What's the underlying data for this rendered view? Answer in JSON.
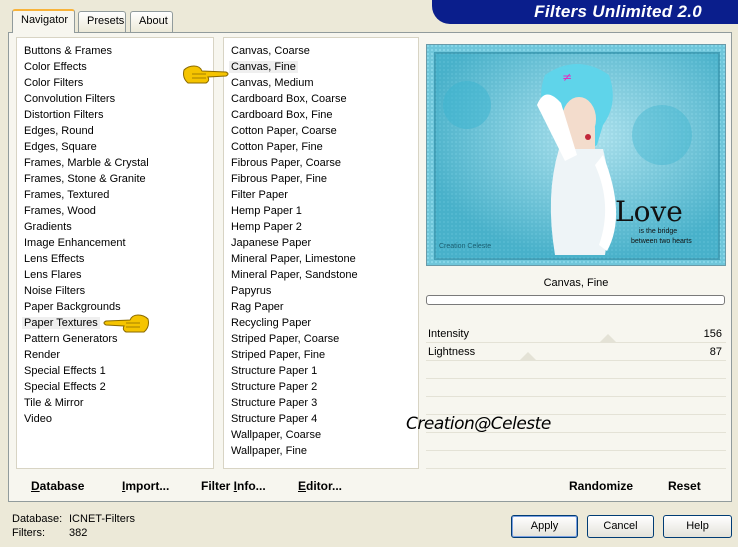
{
  "tabs": [
    {
      "label": "Navigator"
    },
    {
      "label": "Presets"
    },
    {
      "label": "About"
    }
  ],
  "banner_title": "Filters Unlimited 2.0",
  "categories": [
    "Buttons & Frames",
    "Color Effects",
    "Color Filters",
    "Convolution Filters",
    "Distortion Filters",
    "Edges, Round",
    "Edges, Square",
    "Frames, Marble & Crystal",
    "Frames, Stone & Granite",
    "Frames, Textured",
    "Frames, Wood",
    "Gradients",
    "Image Enhancement",
    "Lens Effects",
    "Lens Flares",
    "Noise Filters",
    "Paper Backgrounds",
    "Paper Textures",
    "Pattern Generators",
    "Render",
    "Special Effects 1",
    "Special Effects 2",
    "Tile & Mirror",
    "Video"
  ],
  "filters": [
    "Canvas, Coarse",
    "Canvas, Fine",
    "Canvas, Medium",
    "Cardboard Box, Coarse",
    "Cardboard Box, Fine",
    "Cotton Paper, Coarse",
    "Cotton Paper, Fine",
    "Fibrous Paper, Coarse",
    "Fibrous Paper, Fine",
    "Filter Paper",
    "Hemp Paper 1",
    "Hemp Paper 2",
    "Japanese Paper",
    "Mineral Paper, Limestone",
    "Mineral Paper, Sandstone",
    "Papyrus",
    "Rag Paper",
    "Recycling Paper",
    "Striped Paper, Coarse",
    "Striped Paper, Fine",
    "Structure Paper 1",
    "Structure Paper 2",
    "Structure Paper 3",
    "Structure Paper 4",
    "Wallpaper, Coarse",
    "Wallpaper, Fine"
  ],
  "preview": {
    "love_text": "Love",
    "tagline_1": "is the bridge",
    "tagline_2": "between two hearts",
    "credit_small": "Creation Celeste"
  },
  "current_filter": "Canvas, Fine",
  "progress": 0,
  "params": [
    {
      "label": "Intensity",
      "value": "156"
    },
    {
      "label": "Lightness",
      "value": "87"
    }
  ],
  "signature": "Creation@Celeste",
  "bottom_buttons": {
    "database_u": "D",
    "database_rest": "atabase",
    "import_pre": "I",
    "import_rest": "mport...",
    "filterinfo_pre": "Filter ",
    "filterinfo_u": "I",
    "filterinfo_rest": "nfo...",
    "editor_u": "E",
    "editor_rest": "ditor...",
    "randomize": "Randomize",
    "reset": "Reset"
  },
  "status": {
    "database_label": "Database:",
    "database_value": "ICNET-Filters",
    "filters_label": "Filters:",
    "filters_value": "382"
  },
  "dialog_buttons": {
    "apply": "Apply",
    "cancel": "Cancel",
    "help": "Help"
  },
  "colors": {
    "banner": "#0a1e8c",
    "preview_bg": "#7fd0e2",
    "accent_tab": "#f8b33a",
    "pointer_hand": "#f5c400"
  }
}
